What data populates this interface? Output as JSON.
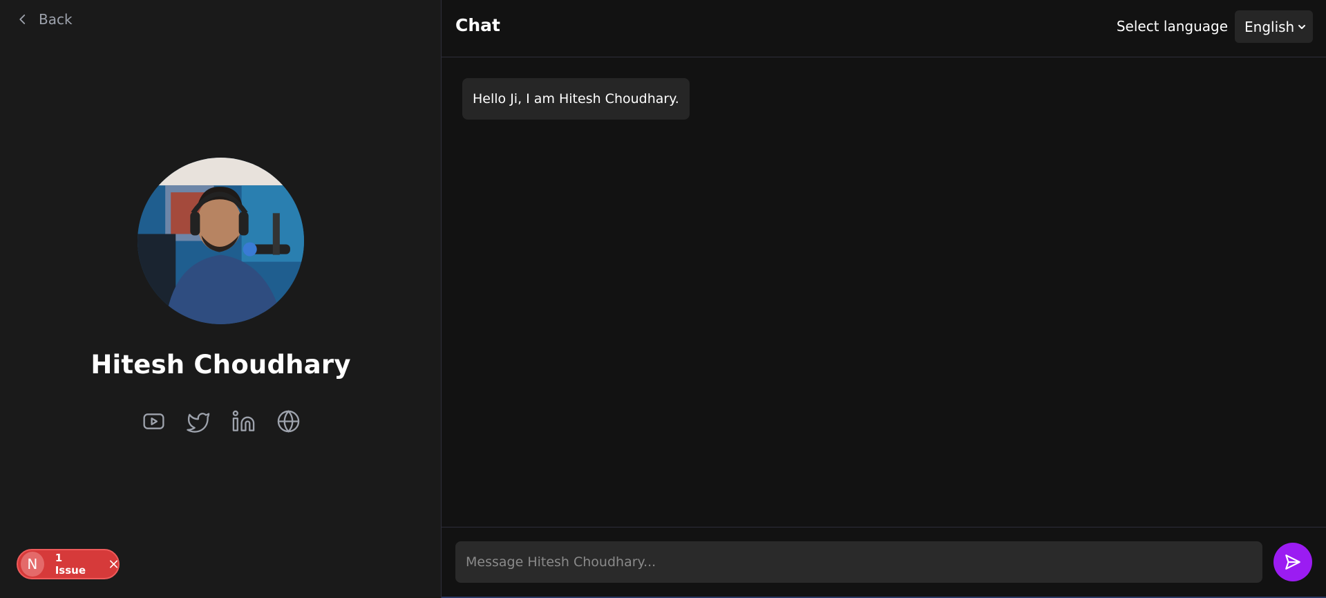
{
  "profile": {
    "back_label": "Back",
    "name": "Hitesh Choudhary",
    "avatar_alt": "Hitesh Choudhary",
    "socials": [
      {
        "icon": "youtube-icon"
      },
      {
        "icon": "twitter-icon"
      },
      {
        "icon": "linkedin-icon"
      },
      {
        "icon": "globe-icon"
      }
    ]
  },
  "issue_badge": {
    "initial": "N",
    "label": "1 Issue"
  },
  "chat": {
    "title": "Chat",
    "language_label": "Select language",
    "language_selected": "English",
    "messages": [
      {
        "sender": "Hitesh Choudhary",
        "text": "Hello Ji, I am Hitesh Choudhary."
      }
    ],
    "input_placeholder": "Message Hitesh Choudhary...",
    "input_value": ""
  },
  "colors": {
    "accent": "#9b1cf2",
    "issue_red": "#d63a3a",
    "panel_bg": "#1a1a1a",
    "chat_bg": "#121212"
  }
}
